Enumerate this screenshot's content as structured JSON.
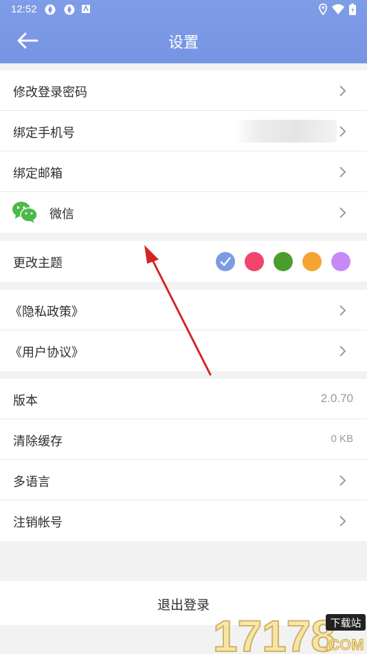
{
  "status_bar": {
    "time": "12:52"
  },
  "header": {
    "title": "设置"
  },
  "account_group": {
    "items": [
      {
        "label": "修改登录密码"
      },
      {
        "label": "绑定手机号"
      },
      {
        "label": "绑定邮箱"
      },
      {
        "label": "微信"
      }
    ]
  },
  "theme": {
    "label": "更改主题",
    "colors": [
      "#7b9be6",
      "#f0456e",
      "#4b9e2c",
      "#f5a332",
      "#c68af5"
    ],
    "selected_index": 0
  },
  "legal_group": {
    "items": [
      {
        "label": "《隐私政策》"
      },
      {
        "label": "《用户协议》"
      }
    ]
  },
  "info_group": {
    "version_label": "版本",
    "version_value": "2.0.70",
    "cache_label": "清除缓存",
    "cache_value": "0 KB",
    "language_label": "多语言",
    "delete_account_label": "注销帐号"
  },
  "logout": {
    "label": "退出登录"
  },
  "watermark": {
    "text": "17178",
    "badge": "下载站",
    "domain": ".COM"
  }
}
